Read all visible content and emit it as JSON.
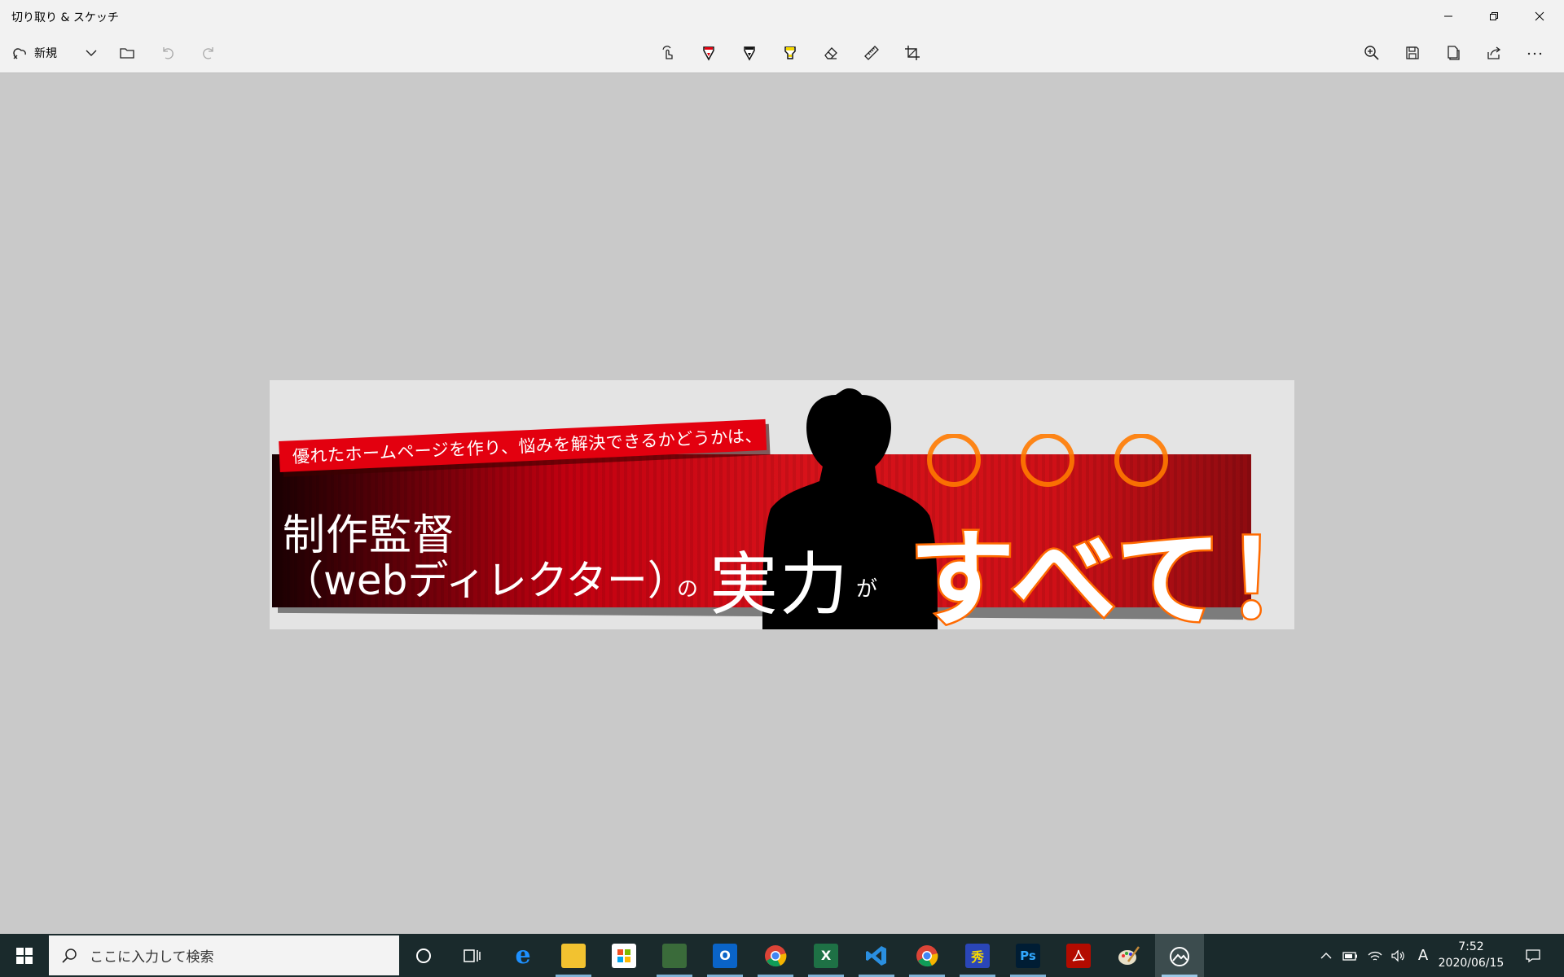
{
  "window": {
    "title": "切り取り & スケッチ",
    "controls": [
      "minimize-icon",
      "restore-icon",
      "close-icon"
    ]
  },
  "toolbar": {
    "new_label": "新規",
    "left_tools": [
      "new-snip-icon",
      "chevron-down-icon",
      "folder-icon",
      "undo-icon",
      "redo-icon"
    ],
    "center_tools": [
      "touch-writing-icon",
      "ballpoint-pen-icon",
      "pencil-icon",
      "highlighter-icon",
      "eraser-icon",
      "ruler-icon",
      "crop-icon"
    ],
    "active_tool": "ballpoint-pen",
    "right_tools": [
      "zoom-in-icon",
      "save-icon",
      "copy-icon",
      "share-icon",
      "more-icon"
    ],
    "colors": {
      "pen": "#e3000f",
      "pencil": "#000000",
      "highlighter": "#f5d800",
      "accent": "#0067c0"
    }
  },
  "image": {
    "ribbon_text": "優れたホームページを作り、悩みを解決できるかどうかは、",
    "line1": "制作監督",
    "line2": "（webディレクター）",
    "particle_no": "の",
    "jitsuryoku": "実力",
    "particle_ga": "が",
    "subete": "すべて！",
    "colors": {
      "banner_red": "#d8121a",
      "outline_orange": "#ff6a00",
      "ribbon_red": "#e3000f"
    }
  },
  "taskbar": {
    "search_placeholder": "ここに入力して検索",
    "apps": [
      "cortana-icon",
      "task-view-icon",
      "edge-icon",
      "file-explorer-icon",
      "store-icon",
      "lock-app-icon",
      "outlook-icon",
      "chrome-icon",
      "excel-icon",
      "vscode-icon",
      "chrome-icon",
      "hidemaru-icon",
      "photoshop-icon",
      "acrobat-icon",
      "paint-icon",
      "snip-sketch-icon"
    ],
    "tray": {
      "ime": "A",
      "time": "7:52",
      "date": "2020/06/15"
    }
  }
}
